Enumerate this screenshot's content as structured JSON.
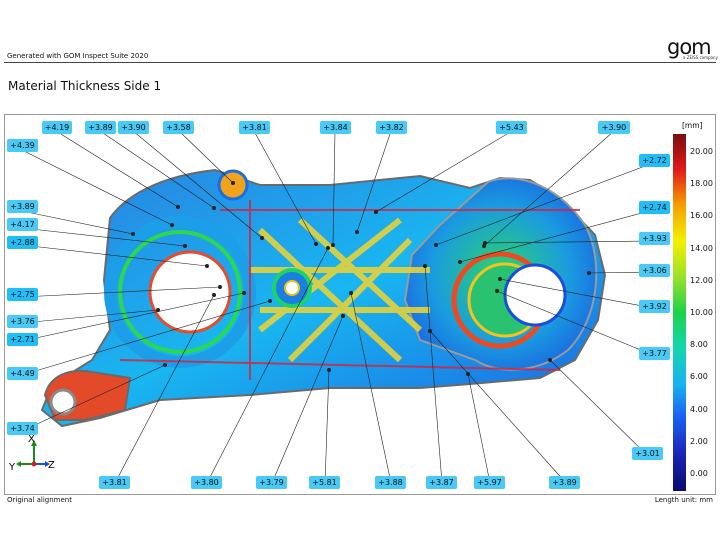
{
  "header": {
    "generated_text": "Generated with GOM Inspect Suite 2020",
    "logo_text": "gom",
    "logo_subtext": "a ZEISS company"
  },
  "report": {
    "title": "Material Thickness Side 1"
  },
  "legend": {
    "unit": "[mm]",
    "ticks": [
      "20.00",
      "18.00",
      "16.00",
      "14.00",
      "12.00",
      "10.00",
      "8.00",
      "6.00",
      "4.00",
      "2.00",
      "0.00"
    ],
    "colors": [
      "#7a0e0e",
      "#e11a1a",
      "#f5a000",
      "#f5f000",
      "#9be12a",
      "#1cd24a",
      "#14d6b0",
      "#18b2f0",
      "#1a5cf0",
      "#1a23b4",
      "#0a0a6e"
    ]
  },
  "axes": {
    "x": "X",
    "y": "Y",
    "z": "Z"
  },
  "labels": [
    {
      "text": "+4.19"
    },
    {
      "text": "+3.89"
    },
    {
      "text": "+3.90"
    },
    {
      "text": "+3.58"
    },
    {
      "text": "+3.81"
    },
    {
      "text": "+3.84"
    },
    {
      "text": "+3.82"
    },
    {
      "text": "+5.43"
    },
    {
      "text": "+3.90"
    },
    {
      "text": "+4.39"
    },
    {
      "text": "+3.89"
    },
    {
      "text": "+4.17"
    },
    {
      "text": "+2.88"
    },
    {
      "text": "+2.75"
    },
    {
      "text": "+3.76"
    },
    {
      "text": "+2.71"
    },
    {
      "text": "+4.49"
    },
    {
      "text": "+3.74"
    },
    {
      "text": "+2.72"
    },
    {
      "text": "+2.74"
    },
    {
      "text": "+3.93"
    },
    {
      "text": "+3.06"
    },
    {
      "text": "+3.92"
    },
    {
      "text": "+3.77"
    },
    {
      "text": "+3.01"
    },
    {
      "text": "+3.81"
    },
    {
      "text": "+3.80"
    },
    {
      "text": "+3.79"
    },
    {
      "text": "+5.81"
    },
    {
      "text": "+3.88"
    },
    {
      "text": "+3.87"
    },
    {
      "text": "+5.97"
    },
    {
      "text": "+3.89"
    }
  ],
  "footer": {
    "alignment": "Original alignment",
    "unit_text": "Length unit: mm"
  }
}
